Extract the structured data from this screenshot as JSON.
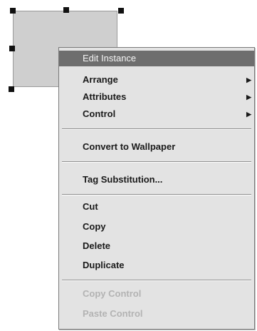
{
  "canvas": {
    "shape_fill": "#cfcfcf",
    "handle_color": "#111111"
  },
  "context_menu": {
    "highlight_color": "#6e6e6e",
    "items": [
      {
        "label": "Edit Instance",
        "state": "highlighted"
      },
      {
        "label": "Arrange",
        "submenu": true,
        "submenu_icon": "submenu-arrow-icon"
      },
      {
        "label": "Attributes",
        "submenu": true,
        "submenu_icon": "submenu-arrow-icon"
      },
      {
        "label": "Control",
        "submenu": true,
        "submenu_icon": "submenu-arrow-icon"
      },
      {
        "label": "Convert to Wallpaper"
      },
      {
        "label": "Tag Substitution..."
      },
      {
        "label": "Cut"
      },
      {
        "label": "Copy"
      },
      {
        "label": "Delete"
      },
      {
        "label": "Duplicate"
      },
      {
        "label": "Copy Control",
        "state": "disabled"
      },
      {
        "label": "Paste Control",
        "state": "disabled"
      }
    ]
  }
}
